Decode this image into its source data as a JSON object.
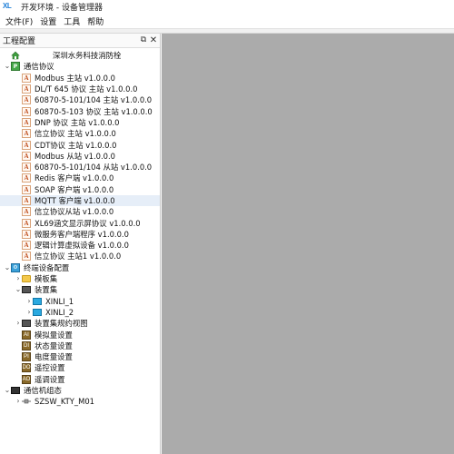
{
  "window": {
    "logo": "XL",
    "title": "开发环境 - 设备管理器"
  },
  "menu": [
    "文件(F)",
    "设置",
    "工具",
    "帮助"
  ],
  "panel": {
    "title": "工程配置",
    "float_icon": "restore-icon",
    "close_icon": "close-icon",
    "close_glyph": "✕",
    "float_glyph": "⧉"
  },
  "tree": [
    {
      "level": 0,
      "toggle": "",
      "icon": "house-icon",
      "label": "深圳水务科技消防栓",
      "center": true
    },
    {
      "level": 0,
      "toggle": "expanded",
      "icon": "protocol-icon",
      "label": "通信协议"
    },
    {
      "level": 1,
      "toggle": "",
      "icon": "doc-icon",
      "label": "Modbus 主站 v1.0.0.0"
    },
    {
      "level": 1,
      "toggle": "",
      "icon": "doc-icon",
      "label": "DL/T 645 协议 主站 v1.0.0.0"
    },
    {
      "level": 1,
      "toggle": "",
      "icon": "doc-icon",
      "label": "60870-5-101/104 主站 v1.0.0.0"
    },
    {
      "level": 1,
      "toggle": "",
      "icon": "doc-icon",
      "label": "60870-5-103 协议 主站 v1.0.0.0"
    },
    {
      "level": 1,
      "toggle": "",
      "icon": "doc-icon",
      "label": "DNP 协议 主站 v1.0.0.0"
    },
    {
      "level": 1,
      "toggle": "",
      "icon": "doc-icon",
      "label": "信立协议 主站 v1.0.0.0"
    },
    {
      "level": 1,
      "toggle": "",
      "icon": "doc-icon",
      "label": "CDT协议 主站 v1.0.0.0"
    },
    {
      "level": 1,
      "toggle": "",
      "icon": "doc-icon",
      "label": "Modbus 从站 v1.0.0.0"
    },
    {
      "level": 1,
      "toggle": "",
      "icon": "doc-icon",
      "label": "60870-5-101/104 从站 v1.0.0.0"
    },
    {
      "level": 1,
      "toggle": "",
      "icon": "doc-icon",
      "label": "Redis 客户端 v1.0.0.0"
    },
    {
      "level": 1,
      "toggle": "",
      "icon": "doc-icon",
      "label": "SOAP 客户端 v1.0.0.0"
    },
    {
      "level": 1,
      "toggle": "",
      "icon": "doc-icon",
      "label": "MQTT 客户端 v1.0.0.0",
      "selected": true
    },
    {
      "level": 1,
      "toggle": "",
      "icon": "doc-icon",
      "label": "信立协议从站 v1.0.0.0"
    },
    {
      "level": 1,
      "toggle": "",
      "icon": "doc-icon",
      "label": "XL69涵文显示屏协议 v1.0.0.0"
    },
    {
      "level": 1,
      "toggle": "",
      "icon": "doc-icon",
      "label": "微服务客户端程序 v1.0.0.0"
    },
    {
      "level": 1,
      "toggle": "",
      "icon": "doc-icon",
      "label": "逻辑计算虚拟设备 v1.0.0.0"
    },
    {
      "level": 1,
      "toggle": "",
      "icon": "doc-icon",
      "label": "信立协议 主站1 v1.0.0.0"
    },
    {
      "level": 0,
      "toggle": "expanded",
      "icon": "device-config-icon",
      "label": "终端设备配置"
    },
    {
      "level": 1,
      "toggle": "collapsed",
      "icon": "folder-icon",
      "label": "模板集"
    },
    {
      "level": 1,
      "toggle": "expanded",
      "icon": "rack-icon",
      "label": "装置集"
    },
    {
      "level": 2,
      "toggle": "collapsed",
      "icon": "monitor-icon",
      "label": "XINLI_1"
    },
    {
      "level": 2,
      "toggle": "collapsed",
      "icon": "monitor-icon",
      "label": "XINLI_2"
    },
    {
      "level": 1,
      "toggle": "collapsed",
      "icon": "rack-icon",
      "label": "装置集规约视图"
    },
    {
      "level": 1,
      "toggle": "",
      "icon": "analog-icon",
      "label": "模拟量设置",
      "glyph": "AI"
    },
    {
      "level": 1,
      "toggle": "",
      "icon": "status-icon",
      "label": "状态量设置",
      "glyph": "DI"
    },
    {
      "level": 1,
      "toggle": "",
      "icon": "energy-icon",
      "label": "电度量设置",
      "glyph": "PI"
    },
    {
      "level": 1,
      "toggle": "",
      "icon": "remote-control-icon",
      "label": "遥控设置",
      "glyph": "DO"
    },
    {
      "level": 1,
      "toggle": "",
      "icon": "remote-adjust-icon",
      "label": "遥调设置",
      "glyph": "AO"
    },
    {
      "level": 0,
      "toggle": "expanded",
      "icon": "terminal-icon",
      "label": "通信机组态"
    },
    {
      "level": 1,
      "toggle": "collapsed",
      "icon": "plug-icon",
      "label": "SZSW_KTY_M01"
    }
  ],
  "colors": {
    "workspace": "#ababab",
    "selection": "#e6eef8",
    "accent": "#1e7fd8"
  }
}
